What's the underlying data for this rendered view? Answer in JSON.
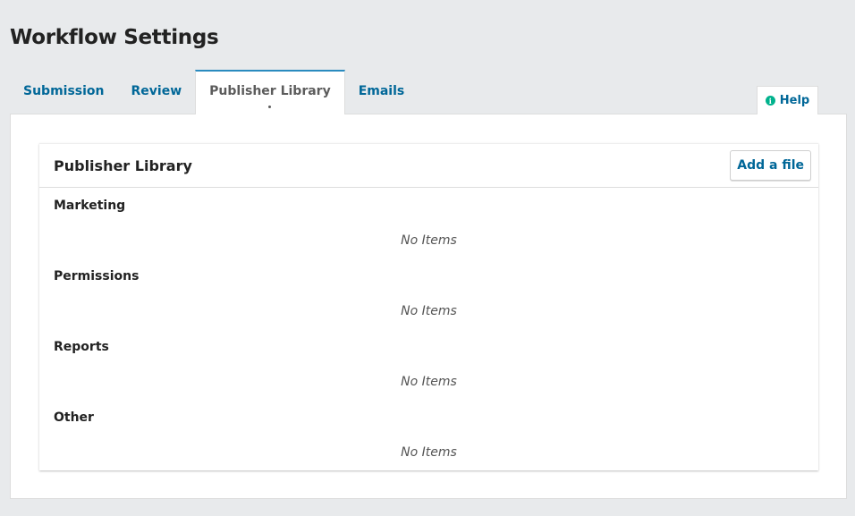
{
  "page": {
    "title": "Workflow Settings"
  },
  "tabs": [
    {
      "label": "Submission",
      "active": false
    },
    {
      "label": "Review",
      "active": false
    },
    {
      "label": "Publisher Library",
      "active": true
    },
    {
      "label": "Emails",
      "active": false
    }
  ],
  "help": {
    "label": "Help",
    "icon": "info-icon"
  },
  "grid": {
    "title": "Publisher Library",
    "add_button_label": "Add a file",
    "categories": [
      {
        "label": "Marketing",
        "empty_text": "No Items"
      },
      {
        "label": "Permissions",
        "empty_text": "No Items"
      },
      {
        "label": "Reports",
        "empty_text": "No Items"
      },
      {
        "label": "Other",
        "empty_text": "No Items"
      }
    ]
  },
  "colors": {
    "link": "#006798",
    "active_tab_border": "#2a8bbf",
    "help_icon": "#00b28d",
    "background": "#e8eaec"
  }
}
